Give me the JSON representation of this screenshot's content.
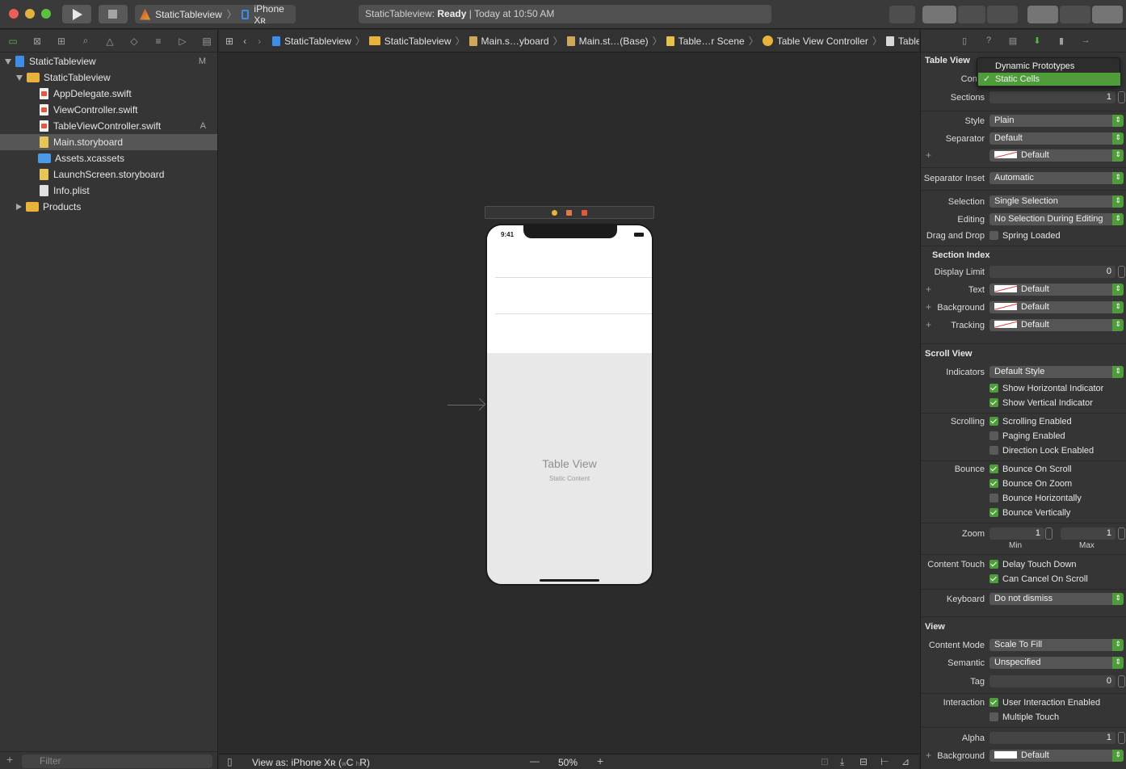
{
  "toolbar": {
    "scheme_app": "StaticTableview",
    "scheme_device": "iPhone Xʀ",
    "status_project": "StaticTableview:",
    "status_state": "Ready",
    "status_time": "| Today at 10:50 AM"
  },
  "navigator": {
    "items": [
      {
        "label": "StaticTableview",
        "badge": "M"
      },
      {
        "label": "StaticTableview"
      },
      {
        "label": "AppDelegate.swift"
      },
      {
        "label": "ViewController.swift"
      },
      {
        "label": "TableViewController.swift",
        "badge": "A"
      },
      {
        "label": "Main.storyboard"
      },
      {
        "label": "Assets.xcassets"
      },
      {
        "label": "LaunchScreen.storyboard"
      },
      {
        "label": "Info.plist"
      },
      {
        "label": "Products"
      }
    ],
    "filter_placeholder": "Filter"
  },
  "jumpbar": {
    "crumbs": [
      "StaticTableview",
      "StaticTableview",
      "Main.s…yboard",
      "Main.st…(Base)",
      "Table…r Scene",
      "Table View Controller",
      "Table View"
    ]
  },
  "canvas": {
    "phone_time": "9:41",
    "table_label": "Table View",
    "table_sub": "Static Content"
  },
  "bottombar": {
    "view_as": "View as: iPhone Xʀ (",
    "size_class_w": "w",
    "size_class_c": "C",
    "size_class_h": "h",
    "size_class_r": "R)",
    "zoom": "50%"
  },
  "inspector": {
    "table_view_title": "Table View",
    "content_label": "Conte",
    "content_menu": [
      "Dynamic Prototypes",
      "Static Cells"
    ],
    "sections_label": "Sections",
    "sections_value": "1",
    "style_label": "Style",
    "style_value": "Plain",
    "separator_label": "Separator",
    "separator_value": "Default",
    "separator_color": "Default",
    "separator_inset_label": "Separator Inset",
    "separator_inset_value": "Automatic",
    "selection_label": "Selection",
    "selection_value": "Single Selection",
    "editing_label": "Editing",
    "editing_value": "No Selection During Editing",
    "drag_drop_label": "Drag and Drop",
    "spring_loaded": "Spring Loaded",
    "section_index_title": "Section Index",
    "display_limit_label": "Display Limit",
    "display_limit_value": "0",
    "text_label": "Text",
    "text_value": "Default",
    "background_label": "Background",
    "background_value": "Default",
    "tracking_label": "Tracking",
    "tracking_value": "Default",
    "scroll_view_title": "Scroll View",
    "indicators_label": "Indicators",
    "indicators_value": "Default Style",
    "show_horizontal": "Show Horizontal Indicator",
    "show_vertical": "Show Vertical Indicator",
    "scrolling_label": "Scrolling",
    "scrolling_enabled": "Scrolling Enabled",
    "paging_enabled": "Paging Enabled",
    "direction_lock": "Direction Lock Enabled",
    "bounce_label": "Bounce",
    "bounce_scroll": "Bounce On Scroll",
    "bounce_zoom": "Bounce On Zoom",
    "bounce_h": "Bounce Horizontally",
    "bounce_v": "Bounce Vertically",
    "zoom_label": "Zoom",
    "zoom_min": "1",
    "zoom_max": "1",
    "zoom_min_label": "Min",
    "zoom_max_label": "Max",
    "content_touch_label": "Content Touch",
    "delay_touch": "Delay Touch Down",
    "cancel_scroll": "Can Cancel On Scroll",
    "keyboard_label": "Keyboard",
    "keyboard_value": "Do not dismiss",
    "view_title": "View",
    "content_mode_label": "Content Mode",
    "content_mode_value": "Scale To Fill",
    "semantic_label": "Semantic",
    "semantic_value": "Unspecified",
    "tag_label": "Tag",
    "tag_value": "0",
    "interaction_label": "Interaction",
    "user_interaction": "User Interaction Enabled",
    "multiple_touch": "Multiple Touch",
    "alpha_label": "Alpha",
    "alpha_value": "1",
    "view_background_label": "Background",
    "view_background_value": "Default"
  },
  "colors": {
    "accent": "#4e9d3a",
    "selected_row": "#565656"
  }
}
